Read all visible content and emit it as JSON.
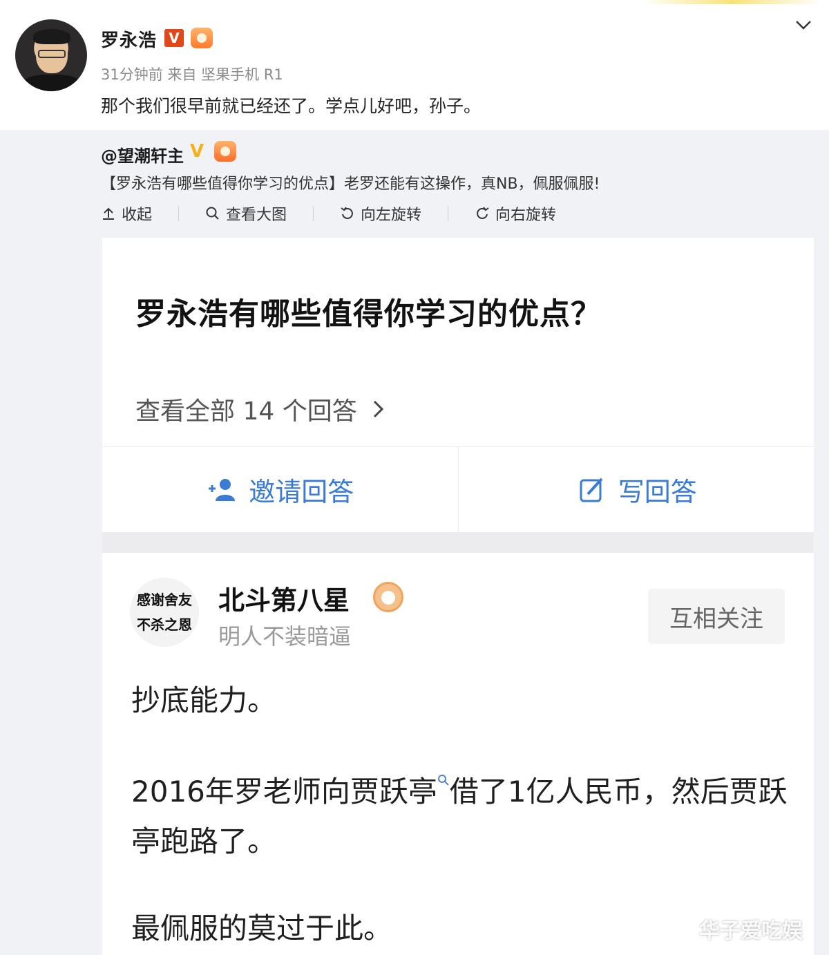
{
  "post": {
    "username": "罗永浩",
    "verified_badge": "V",
    "meta": "31分钟前 来自 坚果手机 R1",
    "text": "那个我们很早前就已经还了。学点儿好吧，孙子。"
  },
  "repost": {
    "username": "@望潮轩主",
    "verified_badge": "V",
    "text": "【罗永浩有哪些值得你学习的优点】老罗还能有这操作，真NB，佩服佩服!",
    "toolbar": [
      {
        "label": "收起",
        "icon": "collapse-icon"
      },
      {
        "label": "查看大图",
        "icon": "search-icon"
      },
      {
        "label": "向左旋转",
        "icon": "rotate-left-icon"
      },
      {
        "label": "向右旋转",
        "icon": "rotate-right-icon"
      }
    ]
  },
  "question": {
    "title": "罗永浩有哪些值得你学习的优点？",
    "view_all": "查看全部 14 个回答",
    "invite_label": "邀请回答",
    "write_label": "写回答"
  },
  "answer": {
    "avatar_line1": "感谢舍友",
    "avatar_line2": "不杀之恩",
    "author": "北斗第八星",
    "bio": "明人不装暗逼",
    "follow_label": "互相关注",
    "paragraph1": "抄底能力。",
    "paragraph2a": "2016年罗老师向贾跃亭",
    "paragraph2b": "借了1亿人民币，然后贾跃亭跑路了。",
    "paragraph3": "最佩服的莫过于此。"
  },
  "watermark": "华子爱吃娱",
  "colors": {
    "accent_blue": "#3a7bd5",
    "weibo_red": "#e2471a",
    "gold": "#f2b21a",
    "repost_bg": "#f1f2f5"
  }
}
